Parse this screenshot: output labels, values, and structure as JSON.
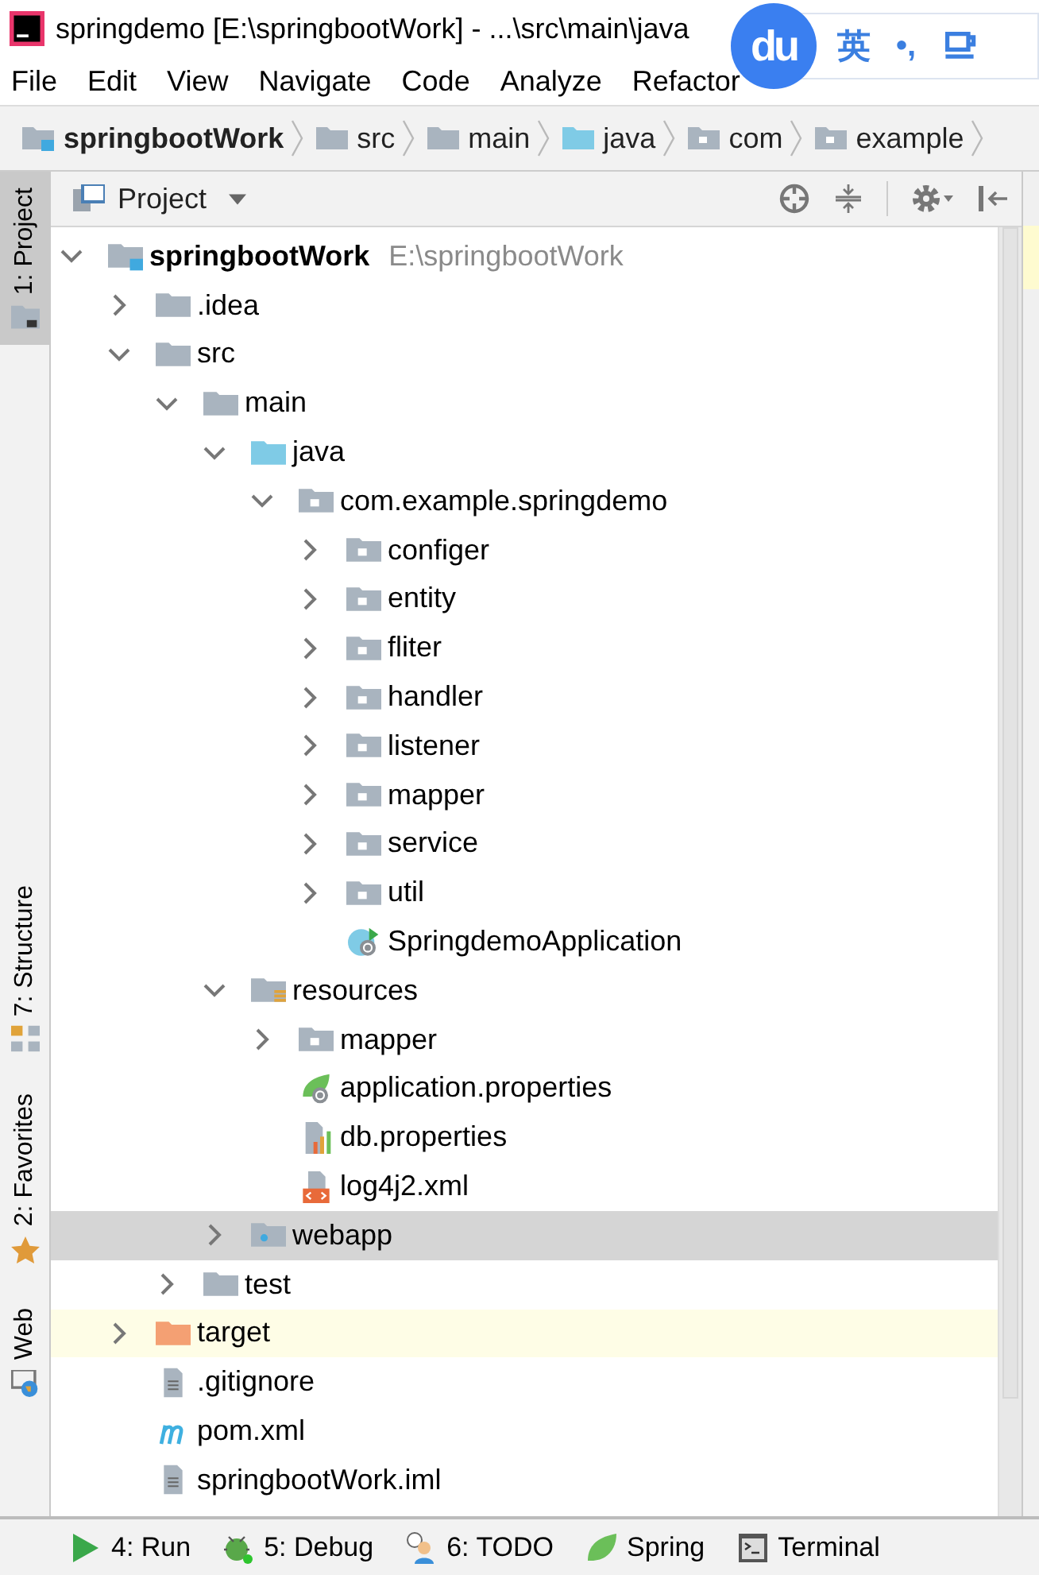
{
  "window": {
    "title": "springdemo [E:\\springbootWork] - ...\\src\\main\\java"
  },
  "ime_toolbar": {
    "logo": "du",
    "mode": "英",
    "punctuation": "•,"
  },
  "menu": [
    "File",
    "Edit",
    "View",
    "Navigate",
    "Code",
    "Analyze",
    "Refactor"
  ],
  "breadcrumb": [
    {
      "label": "springbootWork",
      "kind": "project"
    },
    {
      "label": "src",
      "kind": "folder"
    },
    {
      "label": "main",
      "kind": "folder"
    },
    {
      "label": "java",
      "kind": "source"
    },
    {
      "label": "com",
      "kind": "package"
    },
    {
      "label": "example",
      "kind": "package"
    }
  ],
  "side_tabs": [
    {
      "label": "1: Project",
      "selected": true,
      "kind": "project"
    },
    {
      "label": "7: Structure",
      "selected": false,
      "kind": "structure"
    },
    {
      "label": "2: Favorites",
      "selected": false,
      "kind": "favorites"
    },
    {
      "label": "Web",
      "selected": false,
      "kind": "web"
    }
  ],
  "panel": {
    "title": "Project"
  },
  "tree": [
    {
      "label": "springbootWork",
      "path": "E:\\springbootWork",
      "kind": "project",
      "expanded": true,
      "selected": false,
      "highlighted": false,
      "children": [
        {
          "label": ".idea",
          "kind": "folder",
          "expanded": false,
          "selected": false,
          "highlighted": false
        },
        {
          "label": "src",
          "kind": "folder",
          "expanded": true,
          "selected": false,
          "highlighted": false,
          "children": [
            {
              "label": "main",
              "kind": "folder",
              "expanded": true,
              "selected": false,
              "highlighted": false,
              "children": [
                {
                  "label": "java",
                  "kind": "source",
                  "expanded": true,
                  "selected": false,
                  "highlighted": false,
                  "children": [
                    {
                      "label": "com.example.springdemo",
                      "kind": "package",
                      "expanded": true,
                      "selected": false,
                      "highlighted": false,
                      "children": [
                        {
                          "label": "configer",
                          "kind": "package",
                          "expanded": false,
                          "selected": false,
                          "highlighted": false
                        },
                        {
                          "label": "entity",
                          "kind": "package",
                          "expanded": false,
                          "selected": false,
                          "highlighted": false
                        },
                        {
                          "label": "fliter",
                          "kind": "package",
                          "expanded": false,
                          "selected": false,
                          "highlighted": false
                        },
                        {
                          "label": "handler",
                          "kind": "package",
                          "expanded": false,
                          "selected": false,
                          "highlighted": false
                        },
                        {
                          "label": "listener",
                          "kind": "package",
                          "expanded": false,
                          "selected": false,
                          "highlighted": false
                        },
                        {
                          "label": "mapper",
                          "kind": "package",
                          "expanded": false,
                          "selected": false,
                          "highlighted": false
                        },
                        {
                          "label": "service",
                          "kind": "package",
                          "expanded": false,
                          "selected": false,
                          "highlighted": false
                        },
                        {
                          "label": "util",
                          "kind": "package",
                          "expanded": false,
                          "selected": false,
                          "highlighted": false
                        },
                        {
                          "label": "SpringdemoApplication",
                          "kind": "spring-class",
                          "selected": false,
                          "highlighted": false
                        }
                      ]
                    }
                  ]
                },
                {
                  "label": "resources",
                  "kind": "resources",
                  "expanded": true,
                  "selected": false,
                  "highlighted": false,
                  "children": [
                    {
                      "label": "mapper",
                      "kind": "package",
                      "expanded": false,
                      "selected": false,
                      "highlighted": false
                    },
                    {
                      "label": "application.properties",
                      "kind": "spring-config",
                      "selected": false,
                      "highlighted": false
                    },
                    {
                      "label": "db.properties",
                      "kind": "properties",
                      "selected": false,
                      "highlighted": false
                    },
                    {
                      "label": "log4j2.xml",
                      "kind": "xml",
                      "selected": false,
                      "highlighted": false
                    }
                  ]
                },
                {
                  "label": "webapp",
                  "kind": "web",
                  "expanded": false,
                  "selected": true,
                  "highlighted": false
                }
              ]
            },
            {
              "label": "test",
              "kind": "folder",
              "expanded": false,
              "selected": false,
              "highlighted": false
            }
          ]
        },
        {
          "label": "target",
          "kind": "excluded",
          "expanded": false,
          "selected": false,
          "highlighted": true
        },
        {
          "label": ".gitignore",
          "kind": "text",
          "selected": false,
          "highlighted": false
        },
        {
          "label": "pom.xml",
          "kind": "maven",
          "selected": false,
          "highlighted": false
        },
        {
          "label": "springbootWork.iml",
          "kind": "text",
          "selected": false,
          "highlighted": false
        }
      ]
    }
  ],
  "bottom_tabs": [
    {
      "label": "4: Run",
      "kind": "run"
    },
    {
      "label": "5: Debug",
      "kind": "debug"
    },
    {
      "label": "6: TODO",
      "kind": "todo"
    },
    {
      "label": "Spring",
      "kind": "spring"
    },
    {
      "label": "Terminal",
      "kind": "terminal"
    }
  ]
}
